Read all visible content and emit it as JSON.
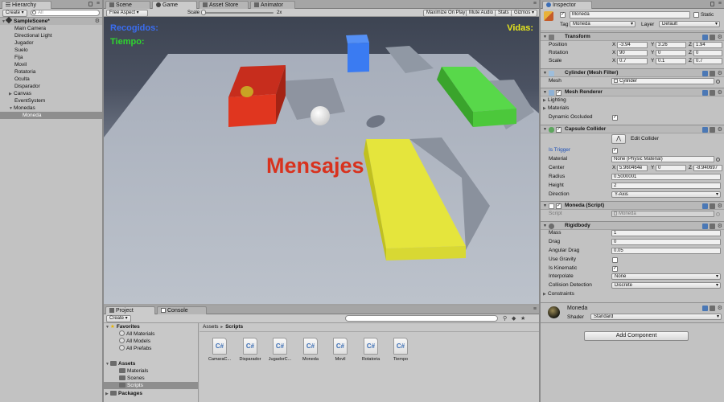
{
  "hierarchy": {
    "tab_label": "Hierarchy",
    "create_label": "Create",
    "search_placeholder": "All",
    "scene_name": "SampleScene*",
    "items": [
      {
        "label": "Main Camera"
      },
      {
        "label": "Directional Light"
      },
      {
        "label": "Jugador"
      },
      {
        "label": "Suelo"
      },
      {
        "label": "Fija"
      },
      {
        "label": "Movil"
      },
      {
        "label": "Rotatoria"
      },
      {
        "label": "Oculta"
      },
      {
        "label": "Disparador"
      },
      {
        "label": "Canvas"
      },
      {
        "label": "EventSystem"
      },
      {
        "label": "Monedas"
      },
      {
        "label": "Moneda"
      }
    ]
  },
  "center_tabs": {
    "scene": "Scene",
    "game": "Game",
    "asset_store": "Asset Store",
    "animator": "Animator"
  },
  "game_toolbar": {
    "aspect": "Free Aspect",
    "scale_label": "Scale",
    "scale_value": "2x",
    "maximize": "Maximize On Play",
    "mute": "Mute Audio",
    "stats": "Stats",
    "gizmos": "Gizmos"
  },
  "game_view": {
    "recogidos": "Recogidos:",
    "tiempo": "Tiempo:",
    "vidas": "Vidas:",
    "mensajes": "Mensajes"
  },
  "project": {
    "tab_project": "Project",
    "tab_console": "Console",
    "create_label": "Create",
    "favorites_label": "Favorites",
    "favorites": [
      "All Materials",
      "All Models",
      "All Prefabs"
    ],
    "assets_label": "Assets",
    "asset_folders": [
      "Materials",
      "Scenes",
      "Scripts"
    ],
    "packages_label": "Packages",
    "breadcrumb_root": "Assets",
    "breadcrumb_sep": "►",
    "breadcrumb_current": "Scripts",
    "file_icon_text": "C#",
    "files": [
      "CamaraC...",
      "Disparador",
      "JugadorC...",
      "Moneda",
      "Movil",
      "Rotatoria",
      "Tiempo"
    ]
  },
  "inspector": {
    "tab_label": "Inspector",
    "object_name": "Moneda",
    "static_label": "Static",
    "tag_label": "Tag",
    "tag_value": "Moneda",
    "layer_label": "Layer",
    "layer_value": "Default",
    "transform": {
      "title": "Transform",
      "position_label": "Position",
      "rotation_label": "Rotation",
      "scale_label": "Scale",
      "position": {
        "x": "-3.94",
        "y": "3.26",
        "z": "1.94"
      },
      "rotation": {
        "x": "90",
        "y": "0",
        "z": "0"
      },
      "scale": {
        "x": "0.7",
        "y": "0.1",
        "z": "0.7"
      }
    },
    "mesh_filter": {
      "title": "Cylinder (Mesh Filter)",
      "mesh_label": "Mesh",
      "mesh_value": "Cylinder"
    },
    "mesh_renderer": {
      "title": "Mesh Renderer",
      "lighting": "Lighting",
      "materials": "Materials",
      "dynamic_occluded": "Dynamic Occluded"
    },
    "capsule_collider": {
      "title": "Capsule Collider",
      "edit_collider": "Edit Collider",
      "is_trigger": "Is Trigger",
      "material_label": "Material",
      "material_value": "None (Physic Material)",
      "center_label": "Center",
      "center": {
        "x": "5.960464e",
        "y": "0",
        "z": "-8.940697"
      },
      "radius_label": "Radius",
      "radius_value": "0.5000001",
      "height_label": "Height",
      "height_value": "2",
      "direction_label": "Direction",
      "direction_value": "Y-Axis"
    },
    "script": {
      "title": "Moneda (Script)",
      "script_label": "Script",
      "script_value": "Moneda"
    },
    "rigidbody": {
      "title": "Rigidbody",
      "mass_label": "Mass",
      "mass_value": "1",
      "drag_label": "Drag",
      "drag_value": "0",
      "angular_drag_label": "Angular Drag",
      "angular_drag_value": "0.05",
      "use_gravity": "Use Gravity",
      "is_kinematic": "Is Kinematic",
      "interpolate_label": "Interpolate",
      "interpolate_value": "None",
      "collision_label": "Collision Detection",
      "collision_value": "Discrete",
      "constraints": "Constraints"
    },
    "material": {
      "name": "Moneda",
      "shader_label": "Shader",
      "shader_value": "Standard"
    },
    "add_component": "Add Component",
    "check_mark": "✓",
    "axis_x": "X",
    "axis_y": "Y",
    "axis_z": "Z"
  },
  "colors": {
    "recogidos": "#3a6df0",
    "tiempo": "#2fd62f",
    "vidas": "#e5e51c",
    "mensajes": "#d8321e",
    "red_block": "#d8311f",
    "blue_block": "#3a7bf2",
    "green_block": "#4fd73a",
    "yellow_block": "#e2e23a"
  }
}
